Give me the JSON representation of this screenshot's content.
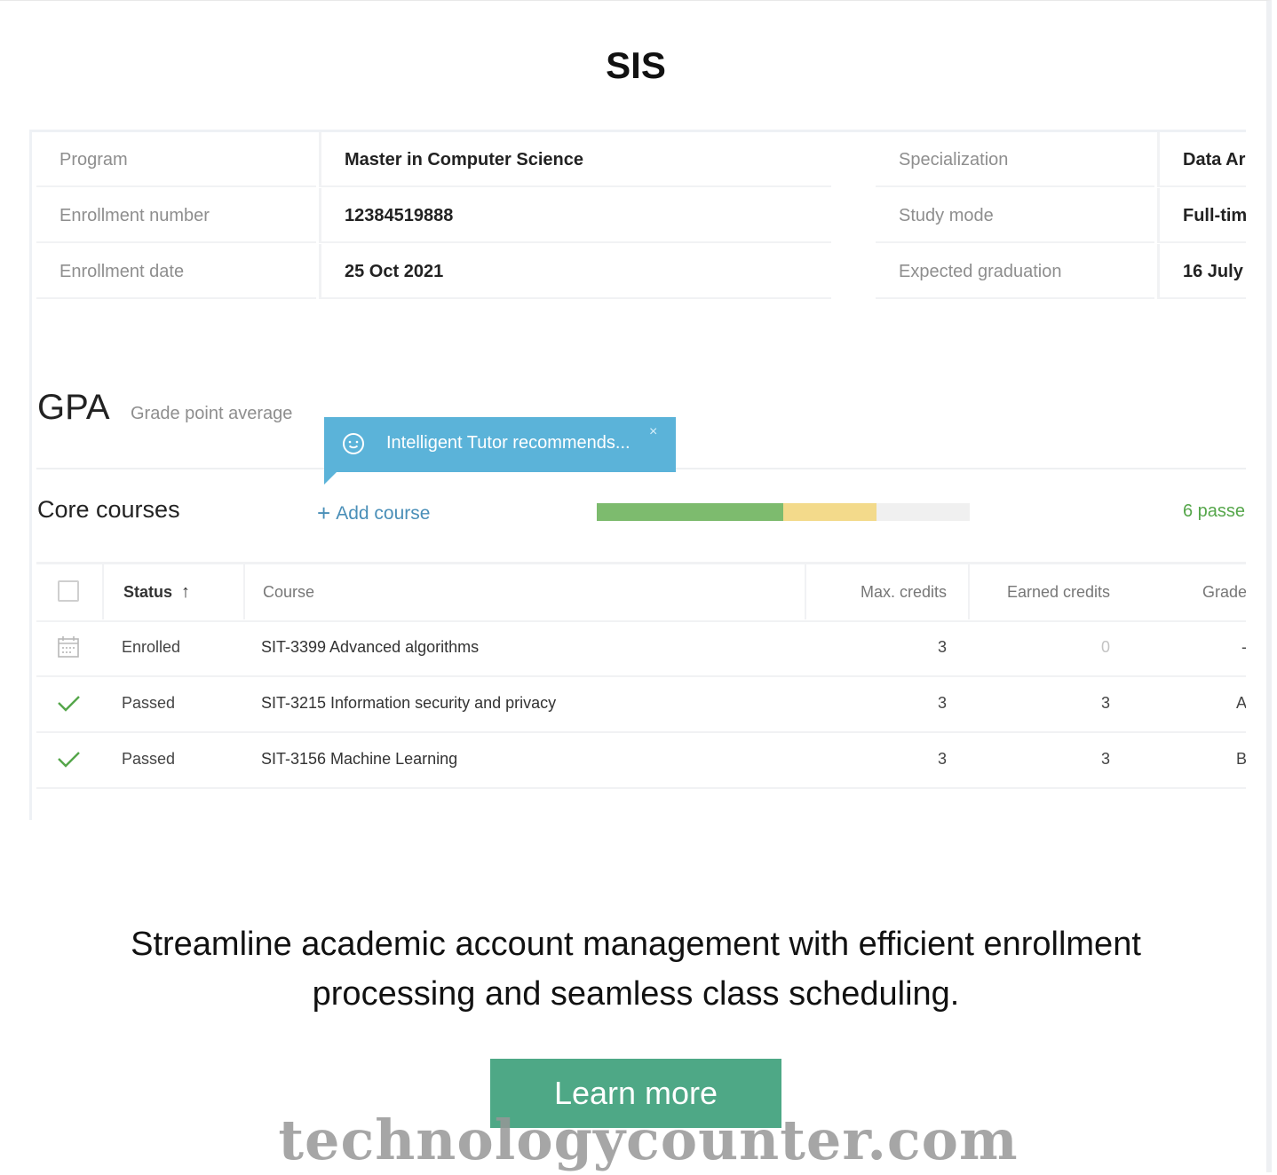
{
  "page": {
    "title": "SIS",
    "description": "Streamline academic account management with efficient enrollment processing and seamless class scheduling.",
    "cta_label": "Learn more",
    "watermark": "technologycounter.com"
  },
  "student_info": {
    "rows": [
      {
        "label1": "Program",
        "value1": "Master in Computer Science",
        "label2": "Specialization",
        "value2": "Data Ar"
      },
      {
        "label1": "Enrollment number",
        "value1": "12384519888",
        "label2": "Study mode",
        "value2": "Full-tim"
      },
      {
        "label1": "Enrollment date",
        "value1": "25 Oct 2021",
        "label2": "Expected graduation",
        "value2": "16 July"
      }
    ]
  },
  "gpa": {
    "title": "GPA",
    "subtitle": "Grade point average"
  },
  "tooltip": {
    "text": "Intelligent Tutor recommends...",
    "close": "×"
  },
  "core_courses": {
    "title": "Core courses",
    "add_label": "Add course",
    "progress": {
      "passed": 0.5,
      "enrolled": 0.25
    },
    "passed_count": "6 passe"
  },
  "courses_table": {
    "headers": {
      "status": "Status",
      "course": "Course",
      "max_credits": "Max. credits",
      "earned_credits": "Earned credits",
      "grade": "Grade"
    },
    "rows": [
      {
        "icon": "calendar-icon",
        "status": "Enrolled",
        "course": "SIT-3399  Advanced algorithms",
        "max": "3",
        "earned": "0",
        "grade": "-"
      },
      {
        "icon": "check-icon",
        "status": "Passed",
        "course": "SIT-3215  Information security and privacy",
        "max": "3",
        "earned": "3",
        "grade": "A"
      },
      {
        "icon": "check-icon",
        "status": "Passed",
        "course": "SIT-3156  Machine Learning",
        "max": "3",
        "earned": "3",
        "grade": "B"
      }
    ]
  },
  "colors": {
    "passed": "#7dbb6e",
    "enrolled": "#f3da8b",
    "tooltip": "#5bb3d9",
    "button": "#4ea886"
  }
}
